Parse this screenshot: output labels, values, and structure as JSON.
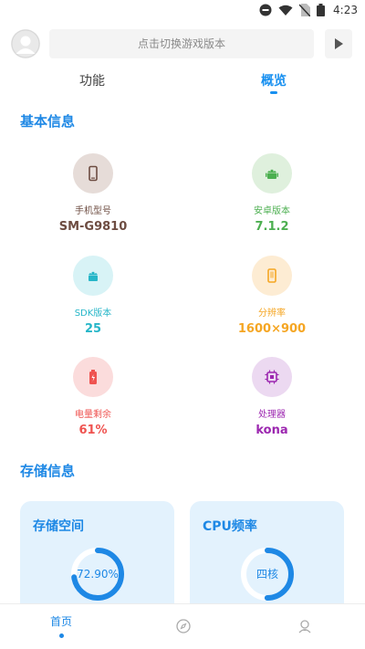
{
  "status_bar": {
    "time": "4:23"
  },
  "search": {
    "placeholder": "点击切换游戏版本"
  },
  "tabs": [
    {
      "label": "功能"
    },
    {
      "label": "概览"
    }
  ],
  "sections": {
    "basic_info": "基本信息",
    "storage_info": "存储信息"
  },
  "info_items": [
    {
      "label": "手机型号",
      "value": "SM-G9810",
      "icon": "phone-icon",
      "color": "#6d4c41",
      "bg": "#e6dcd8"
    },
    {
      "label": "安卓版本",
      "value": "7.1.2",
      "icon": "android-icon",
      "color": "#4caf50",
      "bg": "#dff0dd"
    },
    {
      "label": "SDK版本",
      "value": "25",
      "icon": "sdk-android-icon",
      "color": "#26b6c8",
      "bg": "#d8f3f6"
    },
    {
      "label": "分辨率",
      "value": "1600×900",
      "icon": "resolution-icon",
      "color": "#f5a623",
      "bg": "#fdecd3"
    },
    {
      "label": "电量剩余",
      "value": "61%",
      "icon": "battery-icon",
      "color": "#ef5350",
      "bg": "#fbdcdc"
    },
    {
      "label": "处理器",
      "value": "kona",
      "icon": "cpu-icon",
      "color": "#9c27b0",
      "bg": "#ecd9f1"
    }
  ],
  "cards": {
    "storage": {
      "title": "存储空间",
      "value": "72.90%",
      "fraction": 0.729
    },
    "cpu": {
      "title": "CPU频率",
      "value": "四核",
      "fraction": 0.5
    }
  },
  "bottom_nav": {
    "home": "首页"
  },
  "colors": {
    "accent": "#1e88e5",
    "card_bg": "#e3f2fd"
  }
}
